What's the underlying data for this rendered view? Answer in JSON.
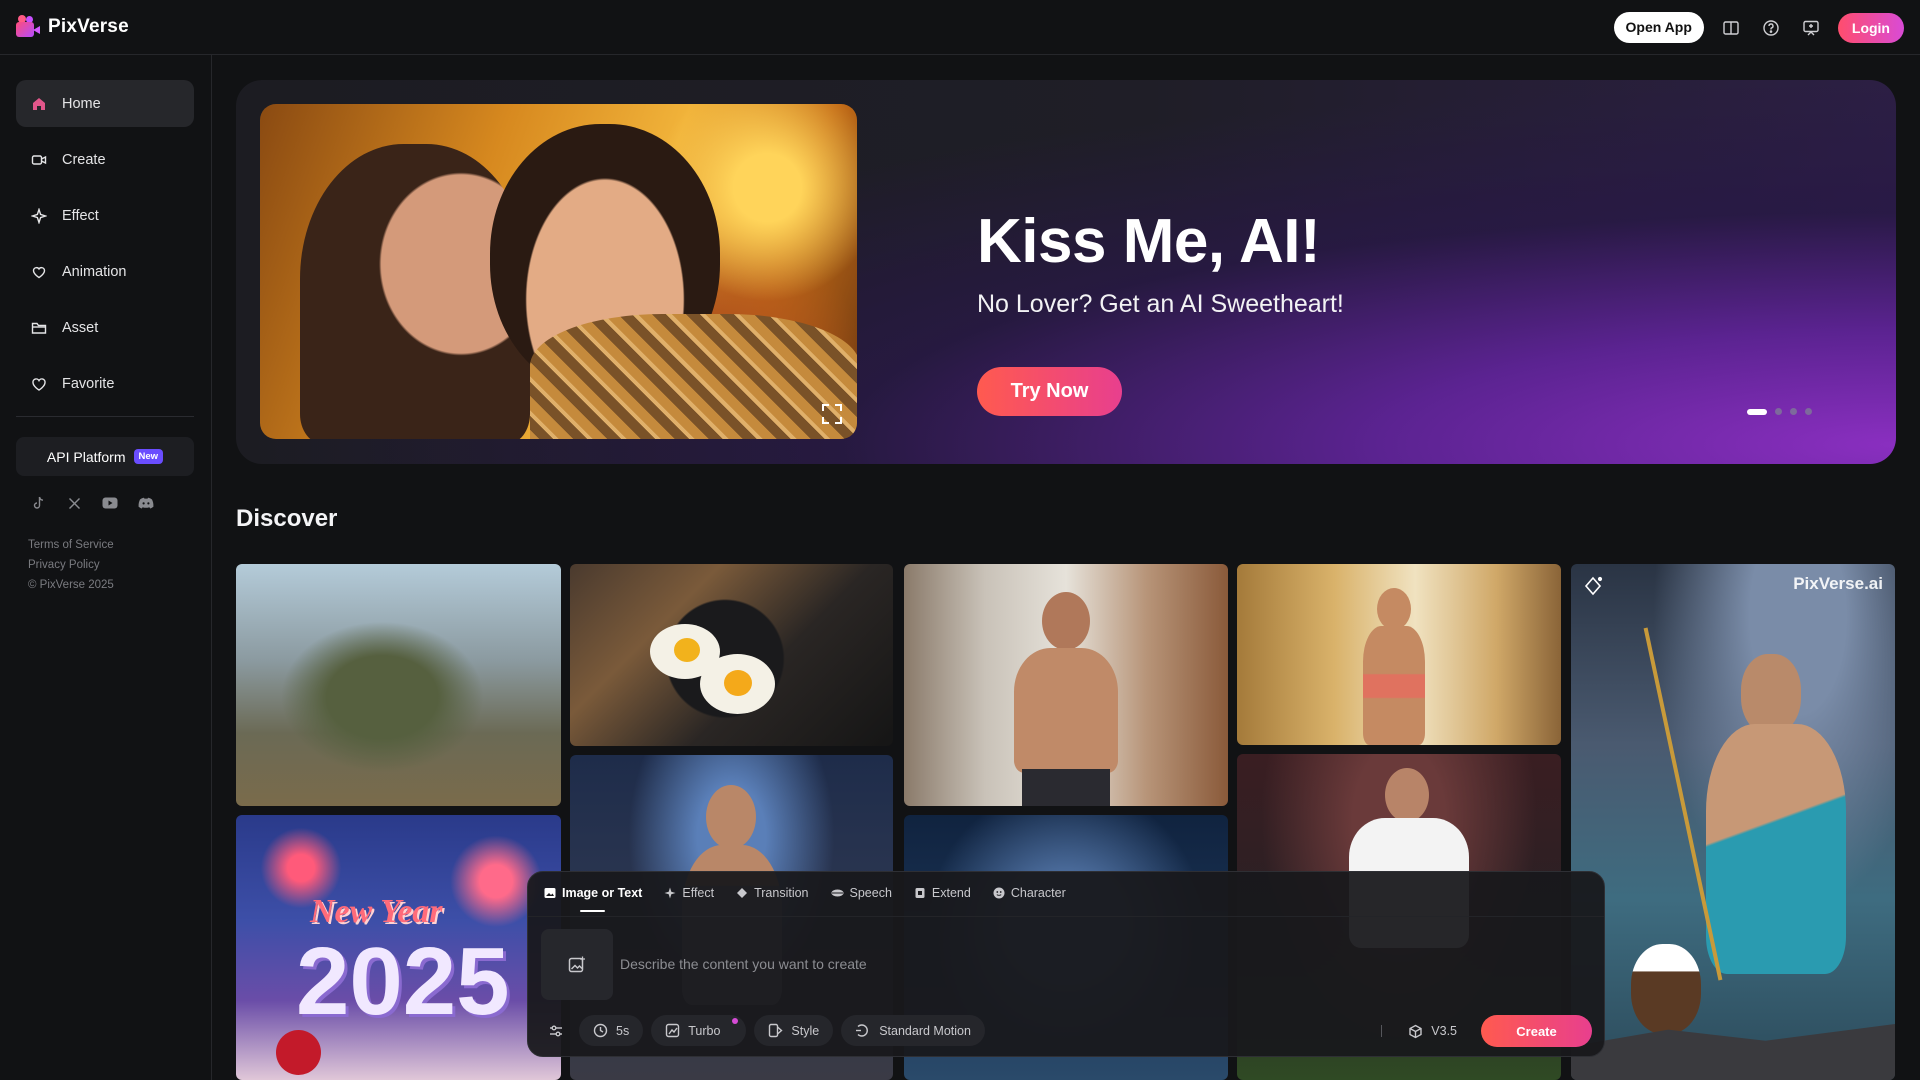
{
  "app": {
    "name": "PixVerse"
  },
  "topbar": {
    "open_app_label": "Open App",
    "login_label": "Login",
    "icons": [
      "book-icon",
      "help-icon",
      "monitor-icon"
    ]
  },
  "sidebar": {
    "items": [
      {
        "label": "Home",
        "icon": "home-icon",
        "active": true
      },
      {
        "label": "Create",
        "icon": "video-icon"
      },
      {
        "label": "Effect",
        "icon": "sparkle-icon"
      },
      {
        "label": "Animation",
        "icon": "heart-hands-icon"
      },
      {
        "label": "Asset",
        "icon": "folder-icon"
      },
      {
        "label": "Favorite",
        "icon": "heart-icon"
      }
    ],
    "api": {
      "label": "API Platform",
      "badge": "New"
    },
    "socials": [
      "tiktok-icon",
      "x-icon",
      "youtube-icon",
      "discord-icon"
    ],
    "legal": {
      "terms": "Terms of Service",
      "privacy": "Privacy Policy",
      "copyright": "© PixVerse 2025"
    }
  },
  "hero": {
    "title": "Kiss Me, AI!",
    "subtitle": "No Lover? Get an AI Sweetheart!",
    "cta": "Try Now",
    "slide_count": 4,
    "active_slide": 1
  },
  "discover": {
    "title": "Discover",
    "watermark": "PixVerse.ai",
    "new_year_line1": "New Year",
    "new_year_line2": "2025"
  },
  "prompt_panel": {
    "tabs": [
      {
        "label": "Image or Text",
        "icon": "image-icon",
        "active": true
      },
      {
        "label": "Effect",
        "icon": "sparkle-icon"
      },
      {
        "label": "Transition",
        "icon": "diamond-icon"
      },
      {
        "label": "Speech",
        "icon": "lips-icon"
      },
      {
        "label": "Extend",
        "icon": "extend-icon"
      },
      {
        "label": "Character",
        "icon": "character-icon"
      }
    ],
    "placeholder": "Describe the content you want to create",
    "controls": {
      "duration": "5s",
      "quality": "Turbo",
      "style": "Style",
      "motion": "Standard Motion"
    },
    "model": "V3.5",
    "create_label": "Create"
  },
  "colors": {
    "accent_start": "#ff5a4f",
    "accent_end": "#e83f8e",
    "background": "#111214"
  }
}
